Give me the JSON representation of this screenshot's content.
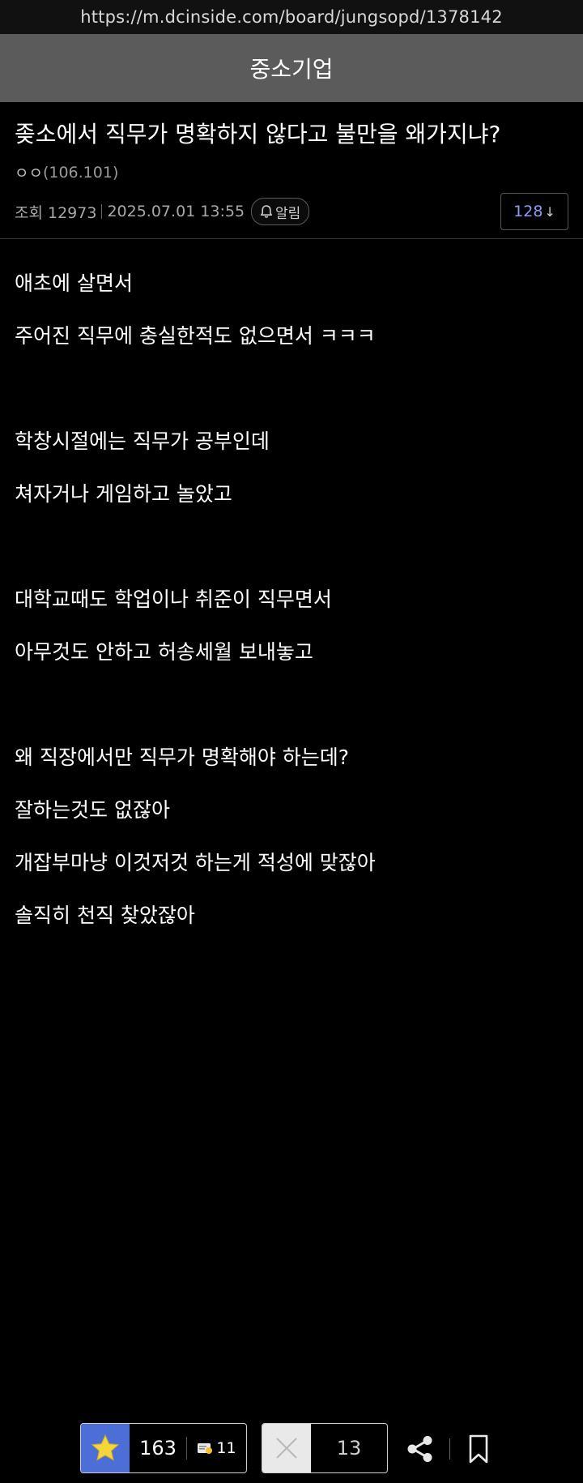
{
  "browser": {
    "url": "https://m.dcinside.com/board/jungsopd/1378142"
  },
  "board": {
    "name": "중소기업"
  },
  "post": {
    "title": "좆소에서 직무가 명확하지 않다고 불만을 왜가지냐?",
    "author_name": "ㅇㅇ",
    "author_ip": "(106.101)",
    "views_label": "조회 12973",
    "datetime": "2025.07.01 13:55",
    "alarm_label": "알림",
    "comment_count": "128",
    "body": [
      "애초에 살면서",
      "주어진 직무에 충실한적도 없으면서 ㅋㅋㅋ",
      "",
      "학창시절에는 직무가 공부인데",
      "쳐자거나 게임하고 놀았고",
      "",
      "대학교때도 학업이나 취준이 직무면서",
      "아무것도 안하고 허송세월 보내놓고",
      "",
      "왜 직장에서만 직무가 명확해야 하는데?",
      "잘하는것도 없잖아",
      "개잡부마냥 이것저것 하는게 적성에 맞잖아",
      "솔직히 천직 찾았잖아"
    ]
  },
  "bottom_bar": {
    "recommend_count": "163",
    "fixed_recommend_count": "11",
    "nonrecommend_count": "13",
    "icons": {
      "recommend": "star-icon",
      "fixed_recommend": "fix-recommend-icon",
      "nonrecommend": "x-icon",
      "share": "share-icon",
      "bookmark": "bookmark-icon"
    }
  },
  "colors": {
    "background": "#000000",
    "header_bg": "#5b5b5b",
    "comment_count": "#8e9cf5",
    "recommend_bg": "#4c6ed6",
    "star": "#f5d63a",
    "nonrecommend_bg": "#e9e9e9"
  }
}
